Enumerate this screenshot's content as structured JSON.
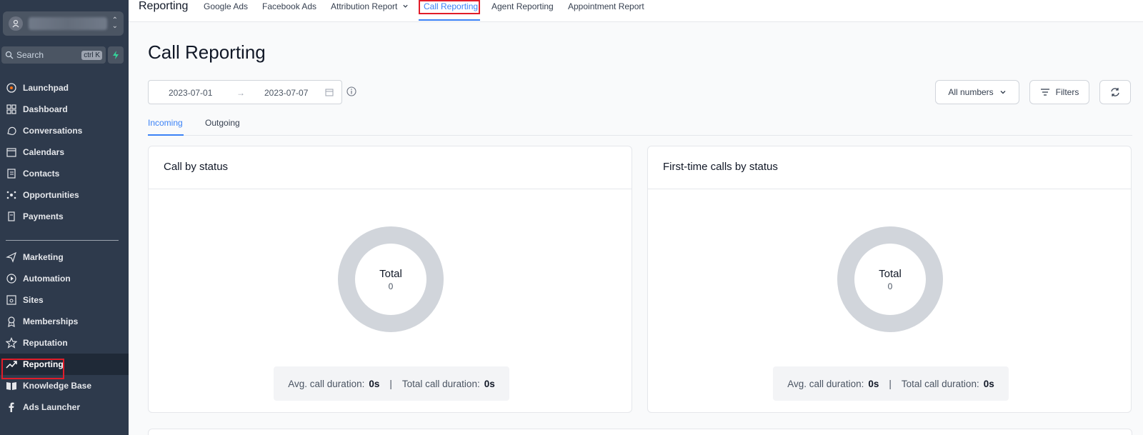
{
  "sidebar": {
    "search_placeholder": "Search",
    "search_shortcut": "ctrl K",
    "items": [
      {
        "label": "Launchpad",
        "icon": "rocket-icon"
      },
      {
        "label": "Dashboard",
        "icon": "grid-icon"
      },
      {
        "label": "Conversations",
        "icon": "chat-icon"
      },
      {
        "label": "Calendars",
        "icon": "calendar-icon"
      },
      {
        "label": "Contacts",
        "icon": "contacts-icon"
      },
      {
        "label": "Opportunities",
        "icon": "network-icon"
      },
      {
        "label": "Payments",
        "icon": "receipt-icon"
      },
      {
        "label": "Marketing",
        "icon": "send-icon"
      },
      {
        "label": "Automation",
        "icon": "automation-icon"
      },
      {
        "label": "Sites",
        "icon": "sites-icon"
      },
      {
        "label": "Memberships",
        "icon": "badge-icon"
      },
      {
        "label": "Reputation",
        "icon": "star-icon"
      },
      {
        "label": "Reporting",
        "icon": "trend-icon",
        "active": true
      },
      {
        "label": "Knowledge Base",
        "icon": "book-icon"
      },
      {
        "label": "Ads Launcher",
        "icon": "facebook-icon"
      }
    ]
  },
  "topnav": {
    "title": "Reporting",
    "links": [
      "Google Ads",
      "Facebook Ads",
      "Attribution Report",
      "Call Reporting",
      "Agent Reporting",
      "Appointment Report"
    ],
    "active": "Call Reporting"
  },
  "main": {
    "title": "Call Reporting",
    "date_start": "2023-07-01",
    "date_end": "2023-07-07",
    "numbers_select": "All numbers",
    "filters_label": "Filters",
    "tabs": [
      "Incoming",
      "Outgoing"
    ],
    "active_tab": "Incoming",
    "cards": [
      {
        "title": "Call by status",
        "center_label": "Total",
        "center_value": "0",
        "avg_label": "Avg. call duration:",
        "avg_value": "0s",
        "sep": "|",
        "total_label": "Total call duration:",
        "total_value": "0s"
      },
      {
        "title": "First-time calls by status",
        "center_label": "Total",
        "center_value": "0",
        "avg_label": "Avg. call duration:",
        "avg_value": "0s",
        "sep": "|",
        "total_label": "Total call duration:",
        "total_value": "0s"
      }
    ]
  },
  "colors": {
    "sidebar_bg": "#2e3a4c",
    "accent": "#3b82f6",
    "highlight_box": "#e11d2a",
    "donut": "#d1d5db"
  }
}
